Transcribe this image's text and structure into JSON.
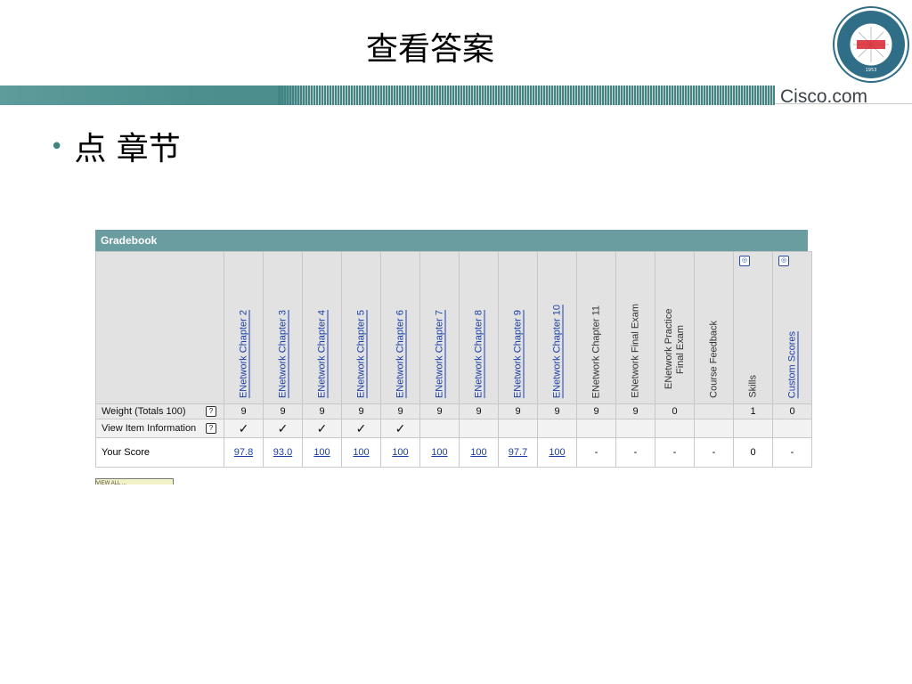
{
  "slide": {
    "title": "查看答案",
    "bullet": "点 章节"
  },
  "brand": {
    "cisco": "Cisco.com",
    "logo_text_top": "CHINA UNIVERSITY OF PETROLEUM",
    "logo_year": "1953",
    "accent_color": "#418484",
    "header_color": "#6a9da0",
    "link_color": "#1b3fa8"
  },
  "gradebook": {
    "title": "Gradebook",
    "columns": [
      {
        "label": "ENetwork Chapter 2",
        "link": true
      },
      {
        "label": "ENetwork Chapter 3",
        "link": true
      },
      {
        "label": "ENetwork Chapter 4",
        "link": true
      },
      {
        "label": "ENetwork Chapter 5",
        "link": true
      },
      {
        "label": "ENetwork Chapter 6",
        "link": true
      },
      {
        "label": "ENetwork Chapter 7",
        "link": true
      },
      {
        "label": "ENetwork Chapter 8",
        "link": true
      },
      {
        "label": "ENetwork Chapter 9",
        "link": true
      },
      {
        "label": "ENetwork Chapter 10",
        "link": true
      },
      {
        "label": "ENetwork Chapter 11",
        "link": false
      },
      {
        "label": "ENetwork Final Exam",
        "link": false
      },
      {
        "label": "ENetwork Practice Final Exam",
        "link": false
      },
      {
        "label": "Course Feedback",
        "link": false
      },
      {
        "label": "Skills",
        "link": false,
        "icon": true
      },
      {
        "label": "Custom Scores",
        "link": true,
        "icon": true
      }
    ],
    "rows": {
      "weight": {
        "label": "Weight (Totals 100)",
        "values": [
          "9",
          "9",
          "9",
          "9",
          "9",
          "9",
          "9",
          "9",
          "9",
          "9",
          "9",
          "0",
          "",
          "1",
          "0"
        ]
      },
      "view": {
        "label": "View Item Information",
        "values": [
          "✓",
          "✓",
          "✓",
          "✓",
          "✓",
          "",
          "",
          "",
          "",
          "",
          "",
          "",
          "",
          "",
          ""
        ]
      },
      "score": {
        "label": "Your Score",
        "values": [
          "97.8",
          "93.0",
          "100",
          "100",
          "100",
          "100",
          "100",
          "97.7",
          "100",
          "-",
          "-",
          "-",
          "-",
          "0",
          "-"
        ],
        "links": [
          true,
          true,
          true,
          true,
          true,
          true,
          true,
          true,
          true,
          false,
          false,
          false,
          false,
          false,
          false
        ]
      }
    },
    "footer_fragment": "VIEW ALL ..."
  }
}
